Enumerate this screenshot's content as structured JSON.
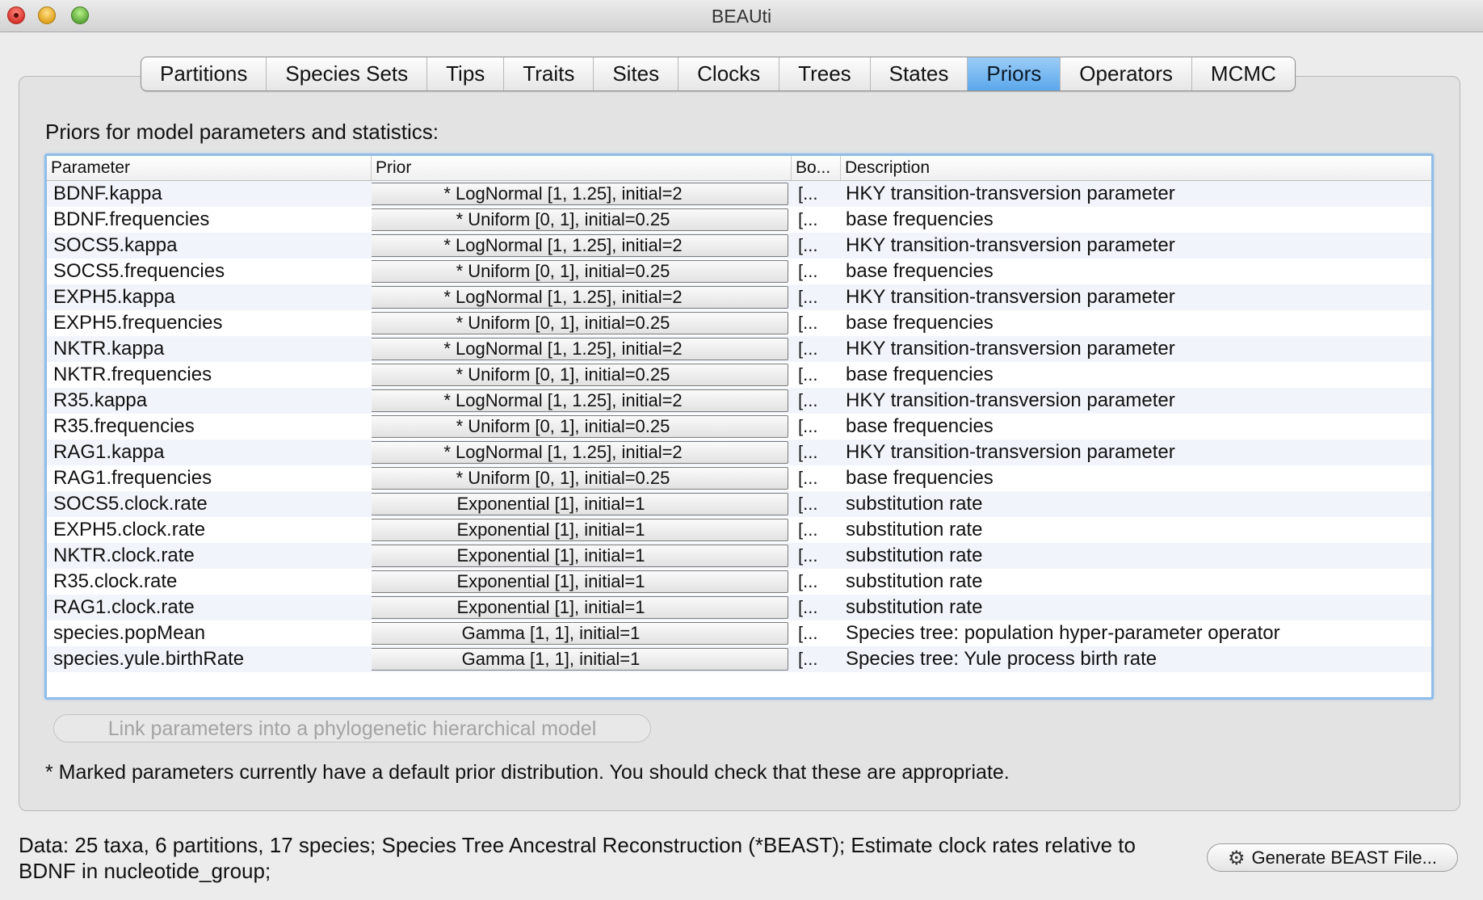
{
  "window": {
    "title": "BEAUti"
  },
  "tabs": [
    "Partitions",
    "Species Sets",
    "Tips",
    "Traits",
    "Sites",
    "Clocks",
    "Trees",
    "States",
    "Priors",
    "Operators",
    "MCMC"
  ],
  "active_tab": "Priors",
  "heading": "Priors for model parameters and statistics:",
  "table": {
    "headers": [
      "Parameter",
      "Prior",
      "Bo...",
      "Description"
    ],
    "rows": [
      {
        "parameter": "BDNF.kappa",
        "prior": "* LogNormal [1, 1.25], initial=2",
        "bound": "[...",
        "description": "HKY transition-transversion parameter"
      },
      {
        "parameter": "BDNF.frequencies",
        "prior": "* Uniform [0, 1], initial=0.25",
        "bound": "[...",
        "description": "base frequencies"
      },
      {
        "parameter": "SOCS5.kappa",
        "prior": "* LogNormal [1, 1.25], initial=2",
        "bound": "[...",
        "description": "HKY transition-transversion parameter"
      },
      {
        "parameter": "SOCS5.frequencies",
        "prior": "* Uniform [0, 1], initial=0.25",
        "bound": "[...",
        "description": "base frequencies"
      },
      {
        "parameter": "EXPH5.kappa",
        "prior": "* LogNormal [1, 1.25], initial=2",
        "bound": "[...",
        "description": "HKY transition-transversion parameter"
      },
      {
        "parameter": "EXPH5.frequencies",
        "prior": "* Uniform [0, 1], initial=0.25",
        "bound": "[...",
        "description": "base frequencies"
      },
      {
        "parameter": "NKTR.kappa",
        "prior": "* LogNormal [1, 1.25], initial=2",
        "bound": "[...",
        "description": "HKY transition-transversion parameter"
      },
      {
        "parameter": "NKTR.frequencies",
        "prior": "* Uniform [0, 1], initial=0.25",
        "bound": "[...",
        "description": "base frequencies"
      },
      {
        "parameter": "R35.kappa",
        "prior": "* LogNormal [1, 1.25], initial=2",
        "bound": "[...",
        "description": "HKY transition-transversion parameter"
      },
      {
        "parameter": "R35.frequencies",
        "prior": "* Uniform [0, 1], initial=0.25",
        "bound": "[...",
        "description": "base frequencies"
      },
      {
        "parameter": "RAG1.kappa",
        "prior": "* LogNormal [1, 1.25], initial=2",
        "bound": "[...",
        "description": "HKY transition-transversion parameter"
      },
      {
        "parameter": "RAG1.frequencies",
        "prior": "* Uniform [0, 1], initial=0.25",
        "bound": "[...",
        "description": "base frequencies"
      },
      {
        "parameter": "SOCS5.clock.rate",
        "prior": "Exponential [1], initial=1",
        "bound": "[...",
        "description": "substitution rate"
      },
      {
        "parameter": "EXPH5.clock.rate",
        "prior": "Exponential [1], initial=1",
        "bound": "[...",
        "description": "substitution rate"
      },
      {
        "parameter": "NKTR.clock.rate",
        "prior": "Exponential [1], initial=1",
        "bound": "[...",
        "description": "substitution rate"
      },
      {
        "parameter": "R35.clock.rate",
        "prior": "Exponential [1], initial=1",
        "bound": "[...",
        "description": "substitution rate"
      },
      {
        "parameter": "RAG1.clock.rate",
        "prior": "Exponential [1], initial=1",
        "bound": "[...",
        "description": "substitution rate"
      },
      {
        "parameter": "species.popMean",
        "prior": "Gamma [1, 1], initial=1",
        "bound": "[...",
        "description": "Species tree: population hyper-parameter operator"
      },
      {
        "parameter": "species.yule.birthRate",
        "prior": "Gamma [1, 1], initial=1",
        "bound": "[...",
        "description": "Species tree: Yule process birth rate"
      }
    ]
  },
  "link_button": "Link parameters into a phylogenetic hierarchical model",
  "footnote": "* Marked parameters currently have a default prior distribution. You should check that these are appropriate.",
  "status": "Data: 25 taxa, 6 partitions, 17 species; Species Tree Ancestral Reconstruction (*BEAST); Estimate clock rates relative to BDNF in nucleotide_group;",
  "generate_button": {
    "label": "Generate BEAST File...",
    "icon": "gear-icon"
  },
  "colors": {
    "active_tab": "#5aa7eb",
    "table_focus_border": "#8fbde7"
  }
}
